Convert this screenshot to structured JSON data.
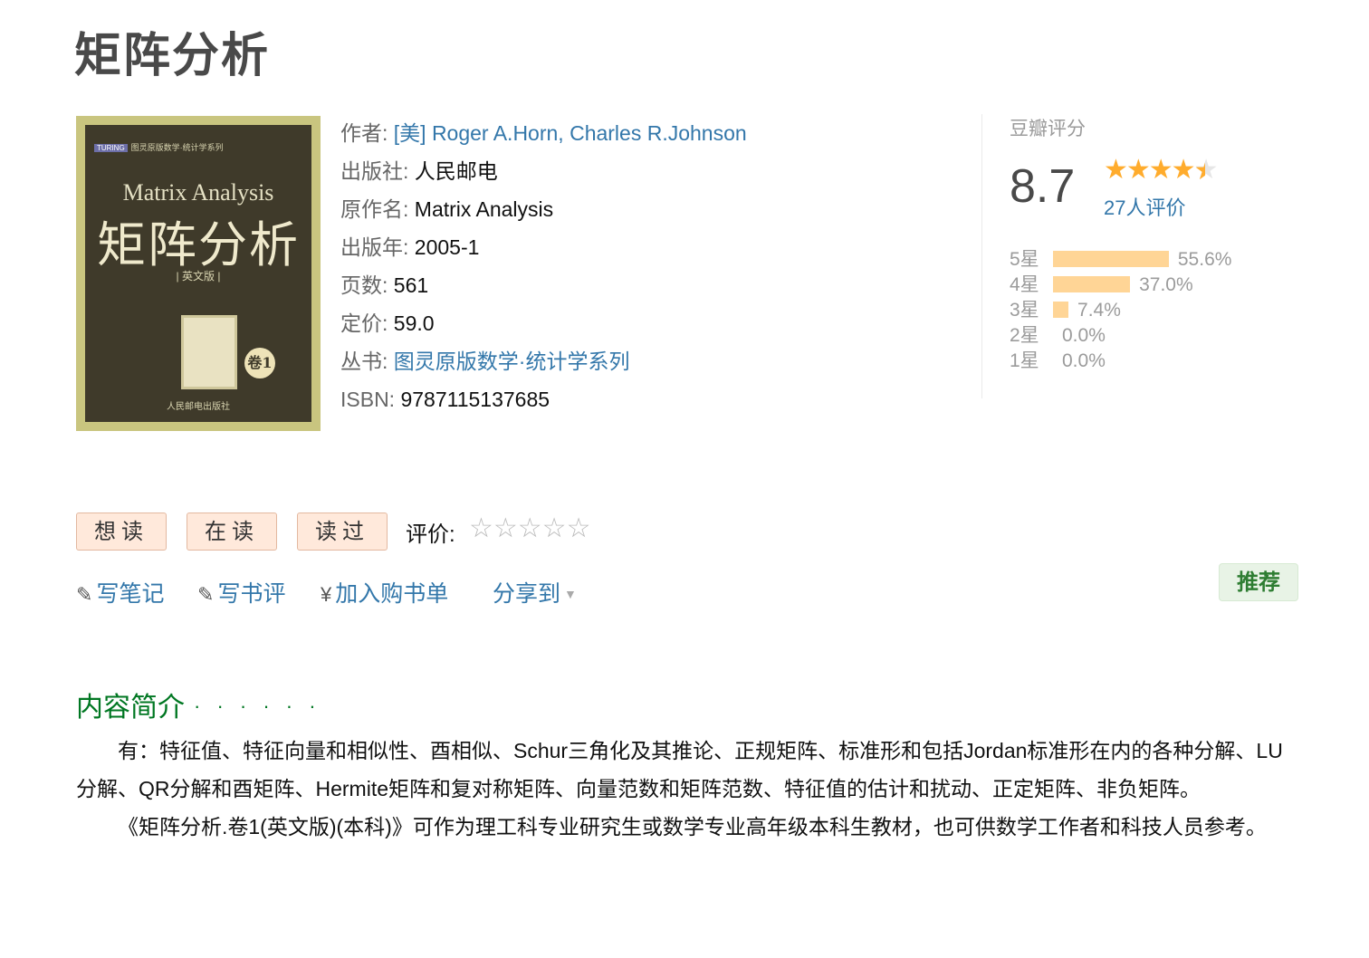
{
  "page_title": "矩阵分析",
  "cover": {
    "series_small": "图灵原版数学·统计学系列",
    "title_en": "Matrix Analysis",
    "title_zh": "矩阵分析",
    "edition": "| 英文版 |",
    "volume": "卷1",
    "publisher": "人民邮电出版社"
  },
  "info": {
    "author_label": "作者:",
    "author_value": "[美] Roger A.Horn, Charles R.Johnson",
    "publisher_label": "出版社:",
    "publisher_value": "人民邮电",
    "original_label": "原作名:",
    "original_value": "Matrix Analysis",
    "year_label": "出版年:",
    "year_value": "2005-1",
    "pages_label": "页数:",
    "pages_value": "561",
    "price_label": "定价:",
    "price_value": "59.0",
    "series_label": "丛书:",
    "series_value": "图灵原版数学·统计学系列",
    "isbn_label": "ISBN:",
    "isbn_value": "9787115137685"
  },
  "rating": {
    "title": "豆瓣评分",
    "score": "8.7",
    "count": "27人评价",
    "star_color": "#ffac2d",
    "bars": [
      {
        "label": "5星",
        "pct": "55.6%",
        "value": 55.6
      },
      {
        "label": "4星",
        "pct": "37.0%",
        "value": 37.0
      },
      {
        "label": "3星",
        "pct": "7.4%",
        "value": 7.4
      },
      {
        "label": "2星",
        "pct": "0.0%",
        "value": 0.0
      },
      {
        "label": "1星",
        "pct": "0.0%",
        "value": 0.0
      }
    ]
  },
  "buttons": {
    "want": "想读",
    "reading": "在读",
    "read": "读过",
    "rate_label": "评价:",
    "rate_stars": "☆☆☆☆☆"
  },
  "actions": {
    "note": "写笔记",
    "review": "写书评",
    "cart": "加入购书单",
    "share": "分享到",
    "recommend": "推荐"
  },
  "intro": {
    "heading": "内容简介",
    "dots": "· · · · · ·",
    "p1": "有：特征值、特征向量和相似性、酉相似、Schur三角化及其推论、正规矩阵、标准形和包括Jordan标准形在内的各种分解、LU分解、QR分解和酉矩阵、Hermite矩阵和复对称矩阵、向量范数和矩阵范数、特征值的估计和扰动、正定矩阵、非负矩阵。",
    "p2": "《矩阵分析.卷1(英文版)(本科)》可作为理工科专业研究生或数学专业高年级本科生教材，也可供数学工作者和科技人员参考。"
  },
  "colors": {
    "link": "#3377aa",
    "heading_green": "#007722",
    "bar": "#ffd596"
  }
}
